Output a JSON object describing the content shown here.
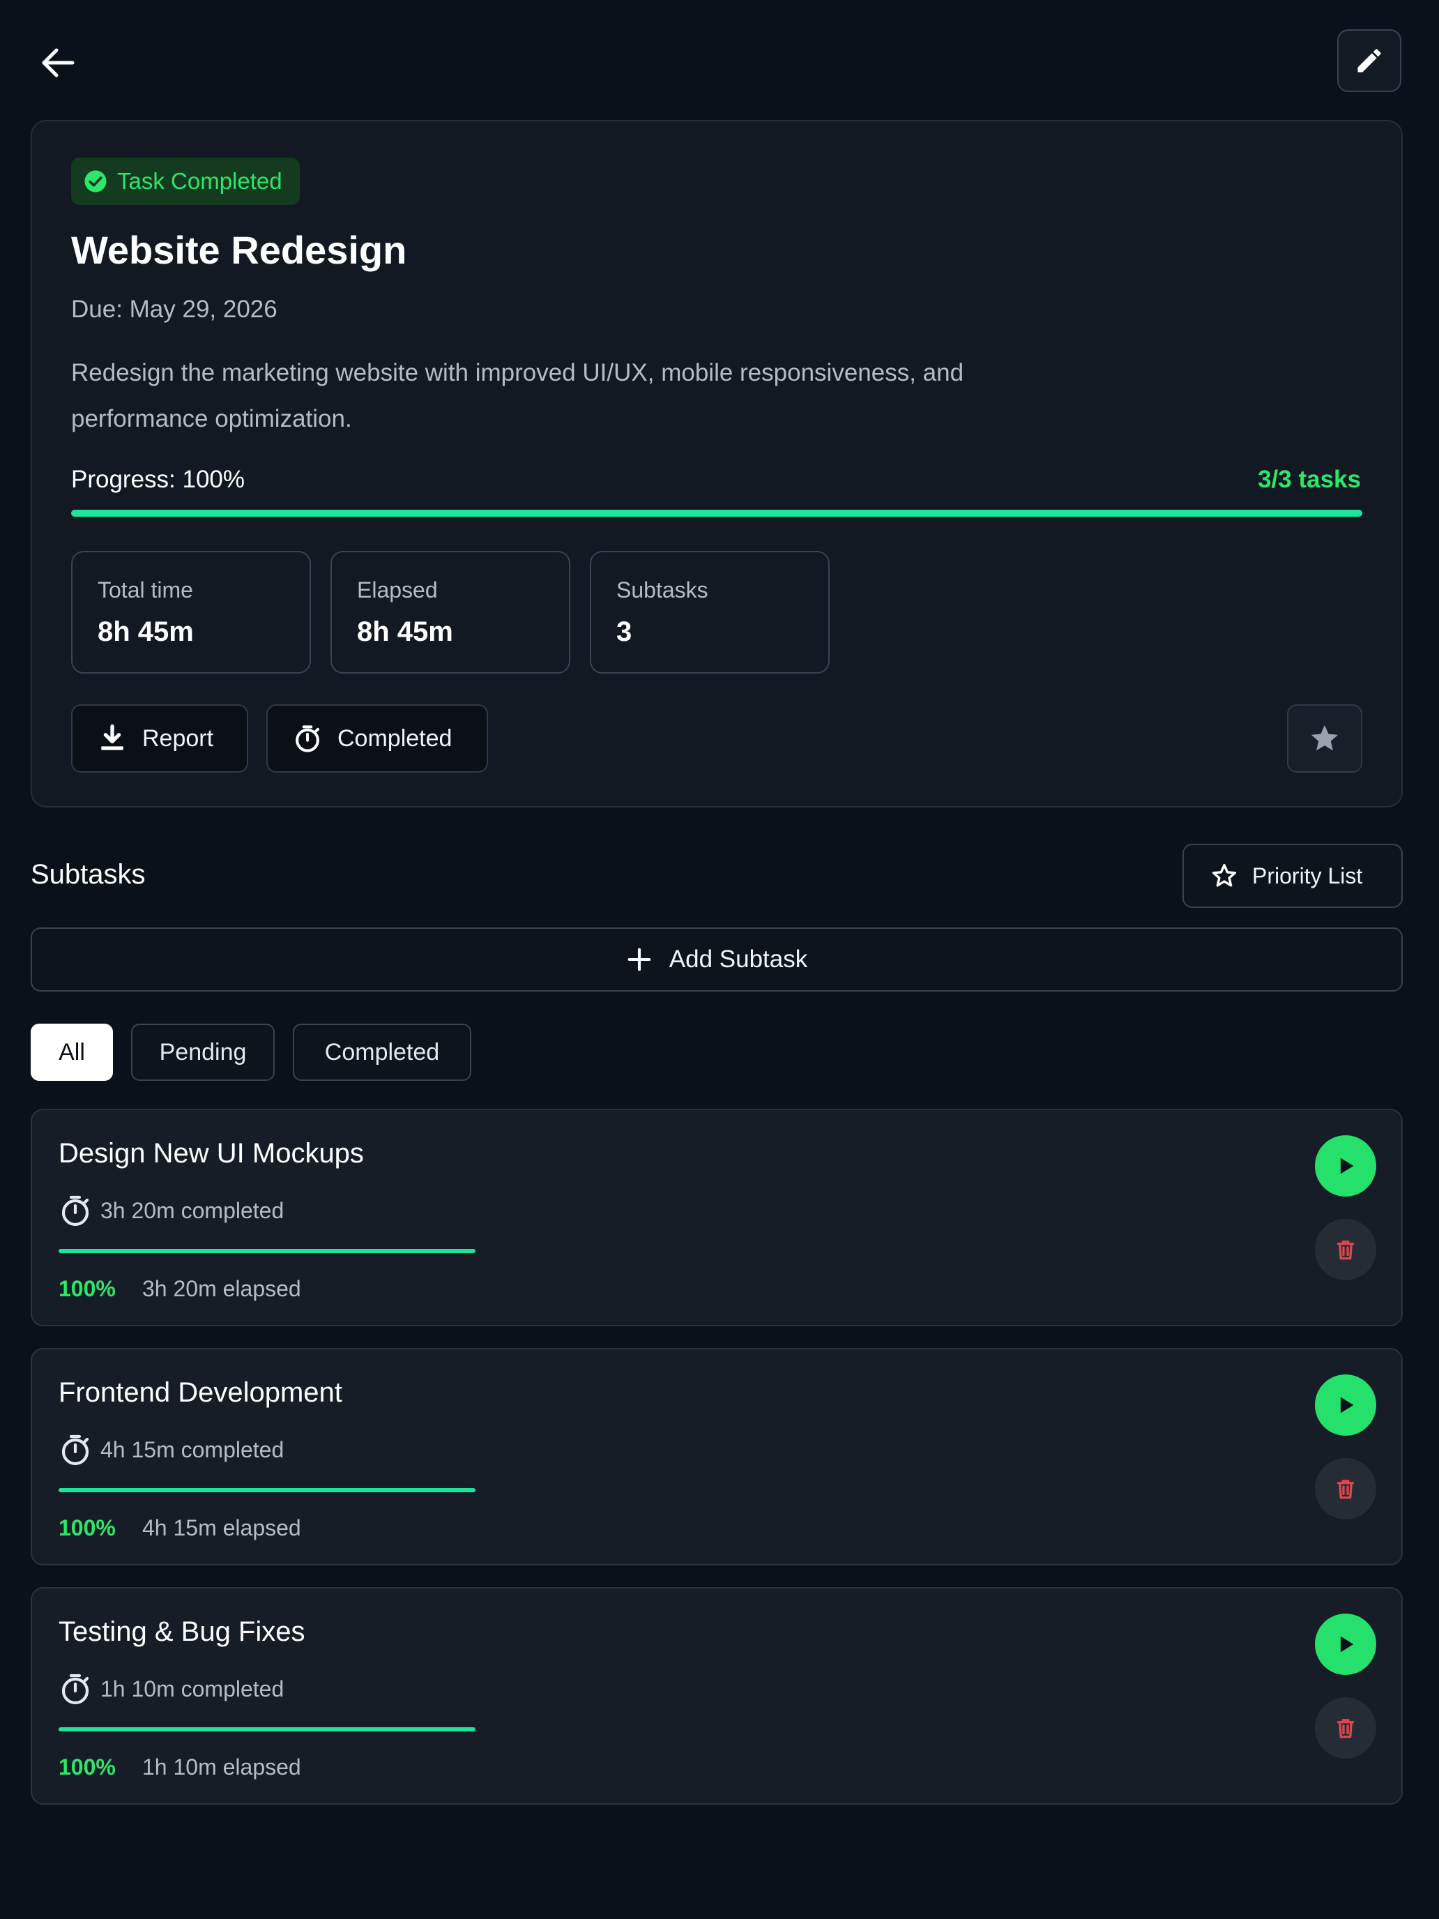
{
  "header": {
    "back_icon": "arrow-left-icon",
    "edit_icon": "pencil-icon"
  },
  "task": {
    "status_badge": "Task Completed",
    "title": "Website Redesign",
    "due": "Due: May 29, 2026",
    "description": "Redesign the marketing website with improved UI/UX, mobile responsiveness, and performance optimization.",
    "progress_label": "Progress:  100%",
    "progress_value": 100,
    "tasks_count": "3/3  tasks",
    "stats": [
      {
        "label": "Total time",
        "value": "8h 45m"
      },
      {
        "label": "Elapsed",
        "value": "8h 45m"
      },
      {
        "label": "Subtasks",
        "value": "3"
      }
    ],
    "actions": {
      "report_label": "Report",
      "timer_label": "Completed"
    }
  },
  "subtasks_section": {
    "heading": "Subtasks",
    "priority_label": "Priority List",
    "add_label": "Add Subtask",
    "filters": [
      "All",
      "Pending",
      "Completed"
    ],
    "active_filter": "All"
  },
  "subtasks": [
    {
      "title": "Design New UI Mockups",
      "time": "3h 20m completed",
      "percent_label": "100%",
      "percent": 100,
      "elapsed": "3h 20m elapsed"
    },
    {
      "title": "Frontend Development",
      "time": "4h 15m completed",
      "percent_label": "100%",
      "percent": 100,
      "elapsed": "4h 15m elapsed"
    },
    {
      "title": "Testing & Bug Fixes",
      "time": "1h 10m completed",
      "percent_label": "100%",
      "percent": 100,
      "elapsed": "1h 10m elapsed"
    }
  ],
  "colors": {
    "accent_green": "#2ee66a",
    "progress_teal": "#1de49a",
    "delete_red": "#e0474c",
    "background": "#0b111a"
  }
}
